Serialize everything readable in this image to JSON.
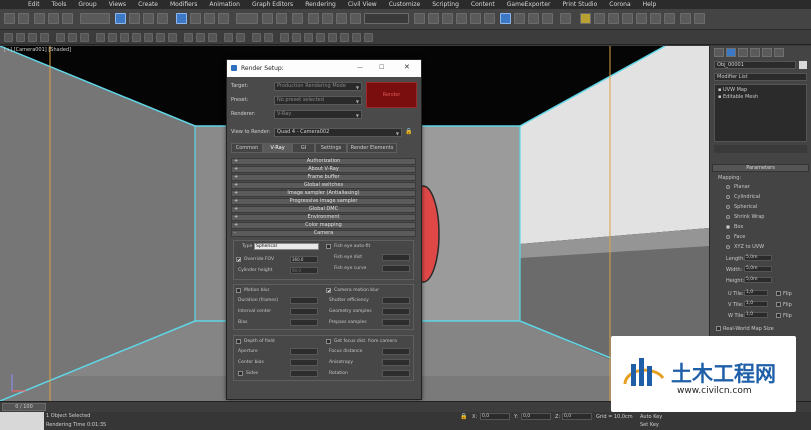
{
  "menu": [
    "Edit",
    "Tools",
    "Group",
    "Views",
    "Create",
    "Modifiers",
    "Animation",
    "Graph Editors",
    "Rendering",
    "Civil View",
    "Customize",
    "Scripting",
    "Content",
    "GameExporter",
    "Print Studio",
    "Corona",
    "Help"
  ],
  "viewport_label": "[+] [Camera001] [Shaded]",
  "render_setup": {
    "title": "Render Setup:",
    "target_label": "Target:",
    "target_value": "Production Rendering Mode",
    "preset_label": "Preset:",
    "preset_value": "No preset selected",
    "renderer_label": "Renderer:",
    "renderer_value": "V-Ray",
    "render_button": "Render",
    "view_label": "View to Render:",
    "view_value": "Quad 4 - Camera002",
    "tabs": [
      "Common",
      "V-Ray",
      "GI",
      "Settings",
      "Render Elements"
    ],
    "rollouts": [
      "Authorization",
      "About V-Ray",
      "Frame buffer",
      "Global switches",
      "Image sampler (Antialiasing)",
      "Progressive image sampler",
      "Global DMC",
      "Environment",
      "Color mapping",
      "Camera"
    ],
    "camera": {
      "type_label": "Type",
      "type_value": "Spherical",
      "fisheye_label": "Fish eye auto-fit",
      "override_fov_label": "Override FOV",
      "override_fov_value": "360.0",
      "fisheye_dist_label": "Fish eye dist",
      "cylinder_height_label": "Cylinder height",
      "cylinder_height_value": "90.0",
      "fisheye_curve_label": "Fish eye curve",
      "motion_blur_label": "Motion blur",
      "camera_motion_blur_label": "Camera motion blur",
      "duration_label": "Duration (frames)",
      "shutter_eff_label": "Shutter efficiency",
      "interval_center_label": "Interval center",
      "geometry_samples_label": "Geometry samples",
      "bias_label": "Bias",
      "prepass_samples_label": "Prepass samples",
      "dof_label": "Depth of field",
      "focus_dist_label": "Get focus dist. from camera",
      "aperture_label": "Aperture",
      "focus_distance_label": "Focus distance",
      "center_bias_label": "Center bias",
      "anisotropy_label": "Anisotropy",
      "sides_label": "Sides",
      "rotation_label": "Rotation"
    }
  },
  "cmd_panel": {
    "object_name": "Obj_00001",
    "modifier_list_label": "Modifier List",
    "stack": [
      "UVW Map",
      "Editable Mesh"
    ],
    "parameters_title": "Parameters",
    "mapping_label": "Mapping:",
    "mapping_options": [
      "Planar",
      "Cylindrical",
      "Spherical",
      "Shrink Wrap",
      "Box",
      "Face",
      "XYZ to UVW"
    ],
    "length_label": "Length:",
    "length_value": "5,0m",
    "width_label": "Width:",
    "width_value": "5,0m",
    "height_label": "Height:",
    "height_value": "5,0m",
    "utile_label": "U Tile:",
    "vtile_label": "V Tile:",
    "wtile_label": "W Tile:",
    "tile_value": "1,0",
    "flip_label": "Flip",
    "realworld_label": "Real-World Map Size"
  },
  "timeline": {
    "frame": "0 / 100"
  },
  "status": {
    "objects": "1 Object Selected",
    "render_time": "Rendering Time 0:01:35",
    "x_label": "X:",
    "y_label": "Y:",
    "z_label": "Z:",
    "x_val": "0,0",
    "y_val": "0,0",
    "z_val": "0,0",
    "grid": "Grid = 10,0cm",
    "autokey": "Auto Key",
    "setkey": "Set Key"
  },
  "watermark": {
    "logo_text": "土木工程网",
    "url": "www.civilcn.com",
    "brand_color": "#1f5fa8"
  }
}
